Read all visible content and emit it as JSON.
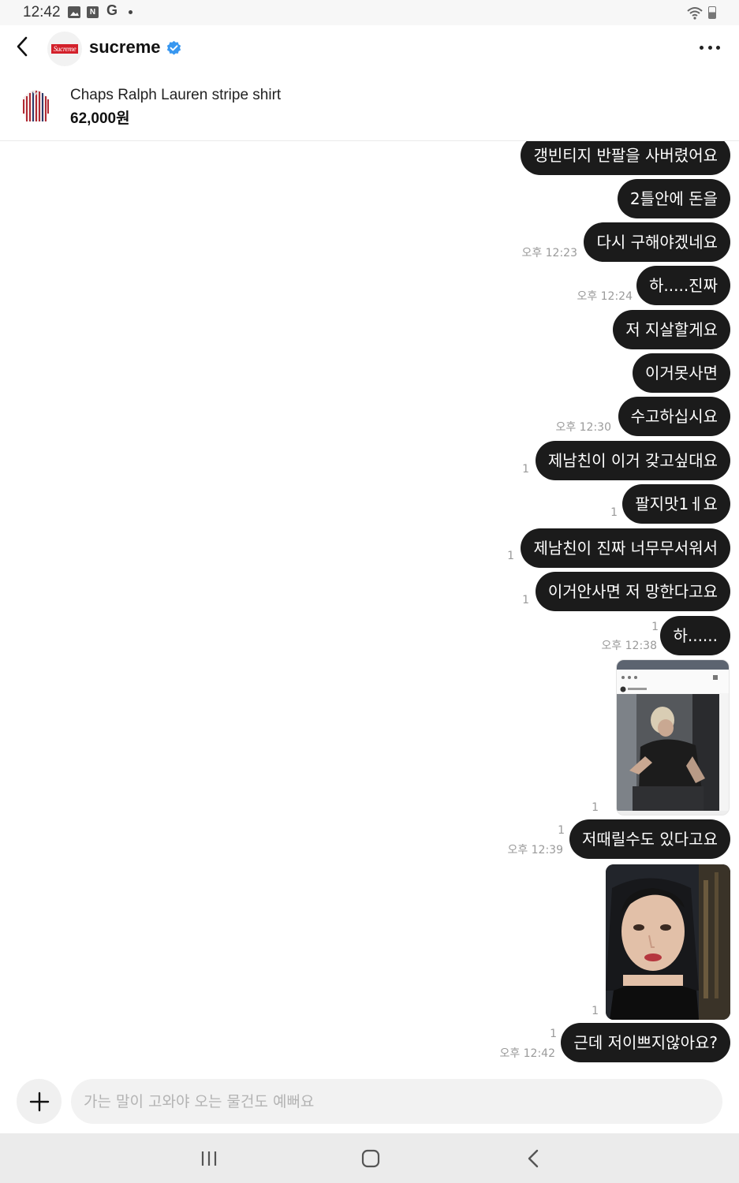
{
  "status_bar": {
    "time": "12:42",
    "notification_icons": [
      "gallery-icon",
      "naver-icon",
      "google-icon",
      "dot-icon"
    ],
    "system_icons": [
      "wifi-icon",
      "battery-icon"
    ]
  },
  "header": {
    "shop_name": "sucreme",
    "avatar_text": "Sucreme",
    "verified": true,
    "accent_color": "#3897f0"
  },
  "product": {
    "title": "Chaps Ralph Lauren stripe shirt",
    "price": "62,000원"
  },
  "messages": [
    {
      "text": "갱빈티지 반팔을 사버렸어요",
      "time": "",
      "read": ""
    },
    {
      "text": "2틀안에 돈을",
      "time": "",
      "read": ""
    },
    {
      "text": "다시 구해야겠네요",
      "time": "오후 12:23",
      "read": ""
    },
    {
      "text": "하.....진짜",
      "time": "오후 12:24",
      "read": ""
    },
    {
      "text": "저 지살할게요",
      "time": "",
      "read": ""
    },
    {
      "text": "이거못사면",
      "time": "",
      "read": ""
    },
    {
      "text": "수고하십시요",
      "time": "오후 12:30",
      "read": ""
    },
    {
      "text": "제남친이 이거 갖고싶대요",
      "time": "",
      "read": "1"
    },
    {
      "text": "팔지맛1ㅔ요",
      "time": "",
      "read": "1"
    },
    {
      "text": "제남친이 진짜 너무무서워서",
      "time": "",
      "read": "1"
    },
    {
      "text": "이거안사면 저 망한다고요",
      "time": "",
      "read": "1"
    },
    {
      "text": "하......",
      "time": "오후 12:38",
      "read": "1"
    },
    {
      "text": "",
      "time": "",
      "read": "1",
      "type": "photo-screenshot"
    },
    {
      "text": "저때릴수도 있다고요",
      "time": "오후 12:39",
      "read": "1"
    },
    {
      "text": "",
      "time": "",
      "read": "1",
      "type": "photo-selfie"
    },
    {
      "text": "근데 저이쁘지않아요?",
      "time": "오후 12:42",
      "read": "1"
    }
  ],
  "input": {
    "placeholder": "가는 말이 고와야 오는 물건도 예뻐요"
  },
  "nav": {
    "buttons": [
      "recents-icon",
      "home-icon",
      "back-icon"
    ]
  }
}
